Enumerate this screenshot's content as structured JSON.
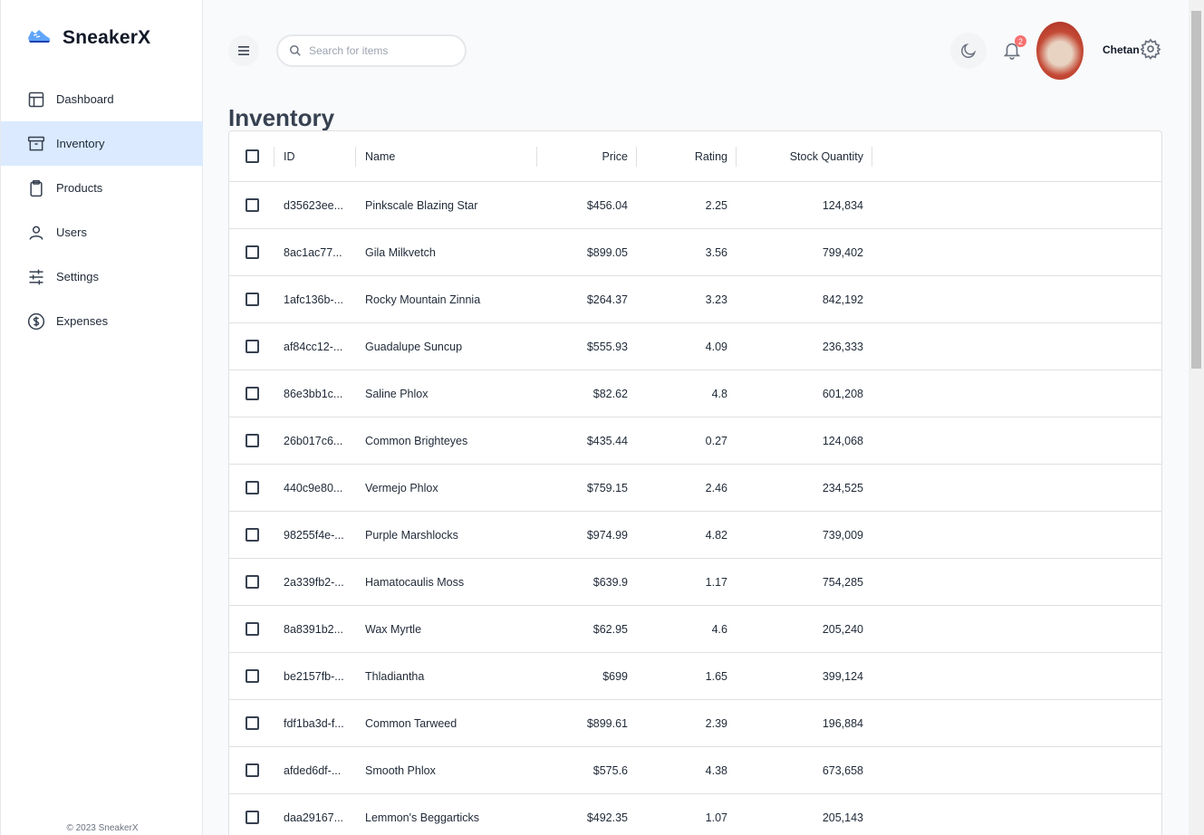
{
  "brand": {
    "name": "SneakerX"
  },
  "sidebar": {
    "items": [
      {
        "label": "Dashboard",
        "icon": "layout-icon",
        "active": false
      },
      {
        "label": "Inventory",
        "icon": "archive-icon",
        "active": true
      },
      {
        "label": "Products",
        "icon": "clipboard-icon",
        "active": false
      },
      {
        "label": "Users",
        "icon": "user-icon",
        "active": false
      },
      {
        "label": "Settings",
        "icon": "sliders-icon",
        "active": false
      },
      {
        "label": "Expenses",
        "icon": "dollar-circle-icon",
        "active": false
      }
    ],
    "footer": "© 2023 SneakerX"
  },
  "header": {
    "search_placeholder": "Search for items",
    "notification_count": "2",
    "user_name": "Chetan"
  },
  "page": {
    "title": "Inventory"
  },
  "table": {
    "columns": [
      "ID",
      "Name",
      "Price",
      "Rating",
      "Stock Quantity"
    ],
    "rows": [
      [
        "d35623ee...",
        "Pinkscale Blazing Star",
        "$456.04",
        "2.25",
        "124,834"
      ],
      [
        "8ac1ac77...",
        "Gila Milkvetch",
        "$899.05",
        "3.56",
        "799,402"
      ],
      [
        "1afc136b-...",
        "Rocky Mountain Zinnia",
        "$264.37",
        "3.23",
        "842,192"
      ],
      [
        "af84cc12-...",
        "Guadalupe Suncup",
        "$555.93",
        "4.09",
        "236,333"
      ],
      [
        "86e3bb1c...",
        "Saline Phlox",
        "$82.62",
        "4.8",
        "601,208"
      ],
      [
        "26b017c6...",
        "Common Brighteyes",
        "$435.44",
        "0.27",
        "124,068"
      ],
      [
        "440c9e80...",
        "Vermejo Phlox",
        "$759.15",
        "2.46",
        "234,525"
      ],
      [
        "98255f4e-...",
        "Purple Marshlocks",
        "$974.99",
        "4.82",
        "739,009"
      ],
      [
        "2a339fb2-...",
        "Hamatocaulis Moss",
        "$639.9",
        "1.17",
        "754,285"
      ],
      [
        "8a8391b2...",
        "Wax Myrtle",
        "$62.95",
        "4.6",
        "205,240"
      ],
      [
        "be2157fb-...",
        "Thladiantha",
        "$699",
        "1.65",
        "399,124"
      ],
      [
        "fdf1ba3d-f...",
        "Common Tarweed",
        "$899.61",
        "2.39",
        "196,884"
      ],
      [
        "afded6df-...",
        "Smooth Phlox",
        "$575.6",
        "4.38",
        "673,658"
      ],
      [
        "daa29167...",
        "Lemmon's Beggarticks",
        "$492.35",
        "1.07",
        "205,143"
      ]
    ]
  }
}
